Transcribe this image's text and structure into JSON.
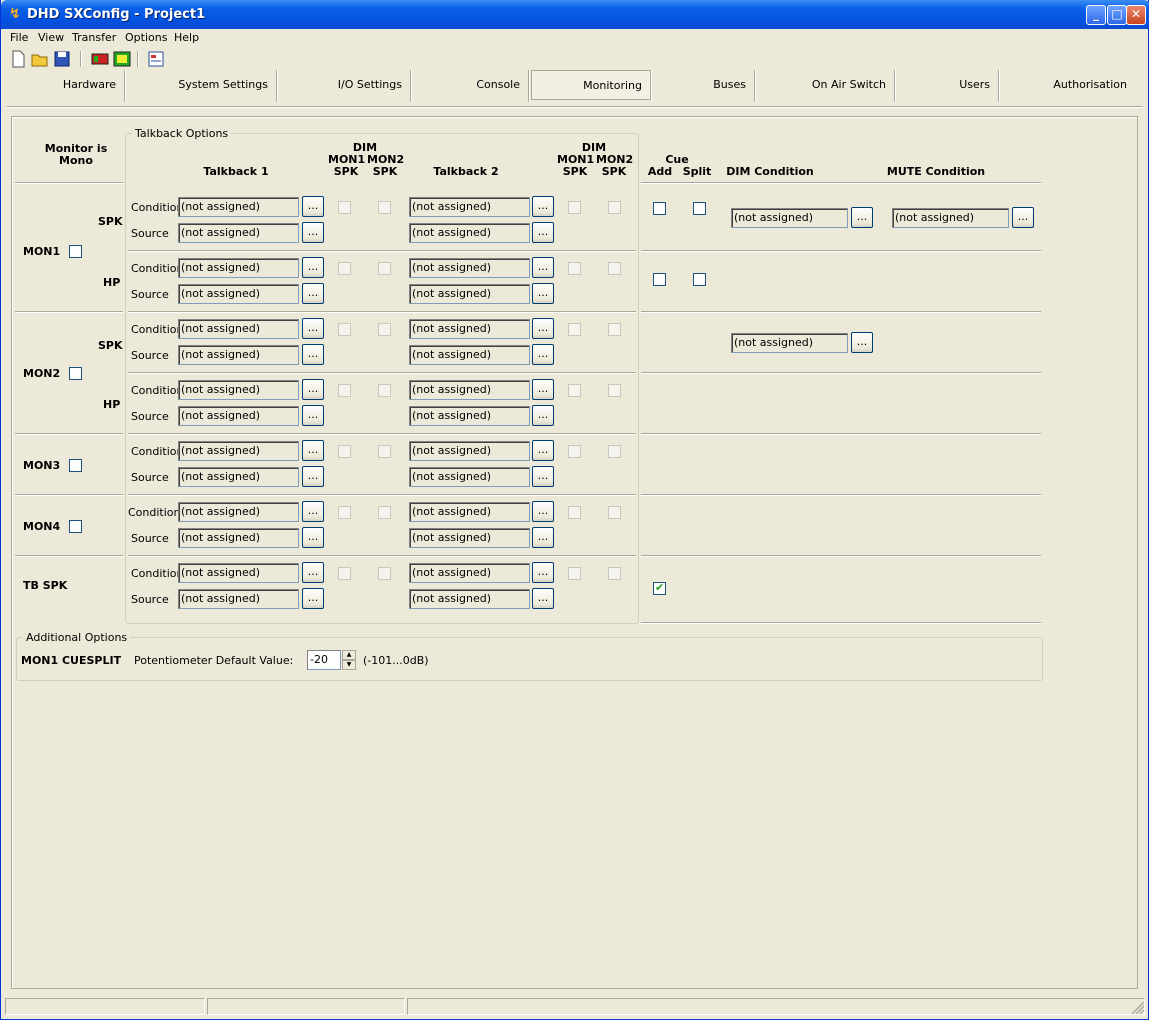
{
  "window": {
    "title": "DHD SXConfig - Project1"
  },
  "menu": {
    "file": "File",
    "view": "View",
    "transfer": "Transfer",
    "options": "Options",
    "help": "Help"
  },
  "tabs": {
    "hardware": "Hardware",
    "system": "System Settings",
    "io": "I/O Settings",
    "console": "Console",
    "monitoring": "Monitoring",
    "buses": "Buses",
    "onair": "On Air Switch",
    "users": "Users",
    "auth": "Authorisation"
  },
  "headers": {
    "monitor_mono": "Monitor is Mono",
    "talkback_group": "Talkback Options",
    "talkback1": "Talkback 1",
    "talkback2": "Talkback 2",
    "dim": "DIM",
    "mon1spk": "MON1 SPK",
    "mon2spk": "MON2 SPK",
    "cue": "Cue",
    "add": "Add",
    "split": "Split",
    "dim_condition": "DIM Condition",
    "mute_condition": "MUTE Condition"
  },
  "labels": {
    "condition": "Condition",
    "source": "Source",
    "spk": "SPK",
    "hp": "HP",
    "not_assigned": "(not assigned)",
    "dots": "..."
  },
  "rows": {
    "mon1": "MON1",
    "mon2": "MON2",
    "mon3": "MON3",
    "mon4": "MON4",
    "tbspk": "TB SPK"
  },
  "additional": {
    "group": "Additional Options",
    "name": "MON1 CUESPLIT",
    "pot_label": "Potentiometer Default Value:",
    "pot_value": "-20",
    "range": "(-101...0dB)"
  },
  "state": {
    "tbspk_cue_add_checked": true
  }
}
